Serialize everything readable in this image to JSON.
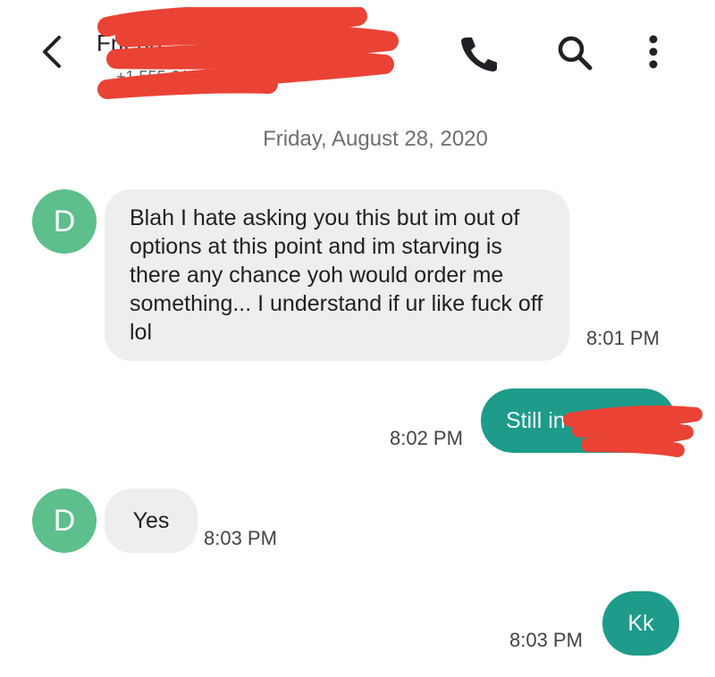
{
  "header": {
    "contact_name": "Friend",
    "contact_number": "+1 555-010-0000",
    "icons": [
      "back-arrow-icon",
      "phone-icon",
      "search-icon",
      "more-vert-icon"
    ]
  },
  "conversation": {
    "date": "Friday, August 28, 2020",
    "messages": [
      {
        "direction": "incoming",
        "avatar_initial": "D",
        "text": "Blah I hate asking you this but im out of options at this point and im starving is there any chance yoh would order me something... I understand if ur like fuck off lol",
        "time": "8:01 PM"
      },
      {
        "direction": "outgoing",
        "text": "Still in",
        "time": "8:02 PM"
      },
      {
        "direction": "incoming",
        "avatar_initial": "D",
        "text": "Yes",
        "time": "8:03 PM"
      },
      {
        "direction": "outgoing",
        "text": "Kk",
        "time": "8:03 PM"
      }
    ]
  },
  "colors": {
    "incoming_bubble": "#eeeeef",
    "outgoing_bubble": "#1e9b8a",
    "avatar": "#5cbf8c",
    "redaction": "#ea4335"
  }
}
